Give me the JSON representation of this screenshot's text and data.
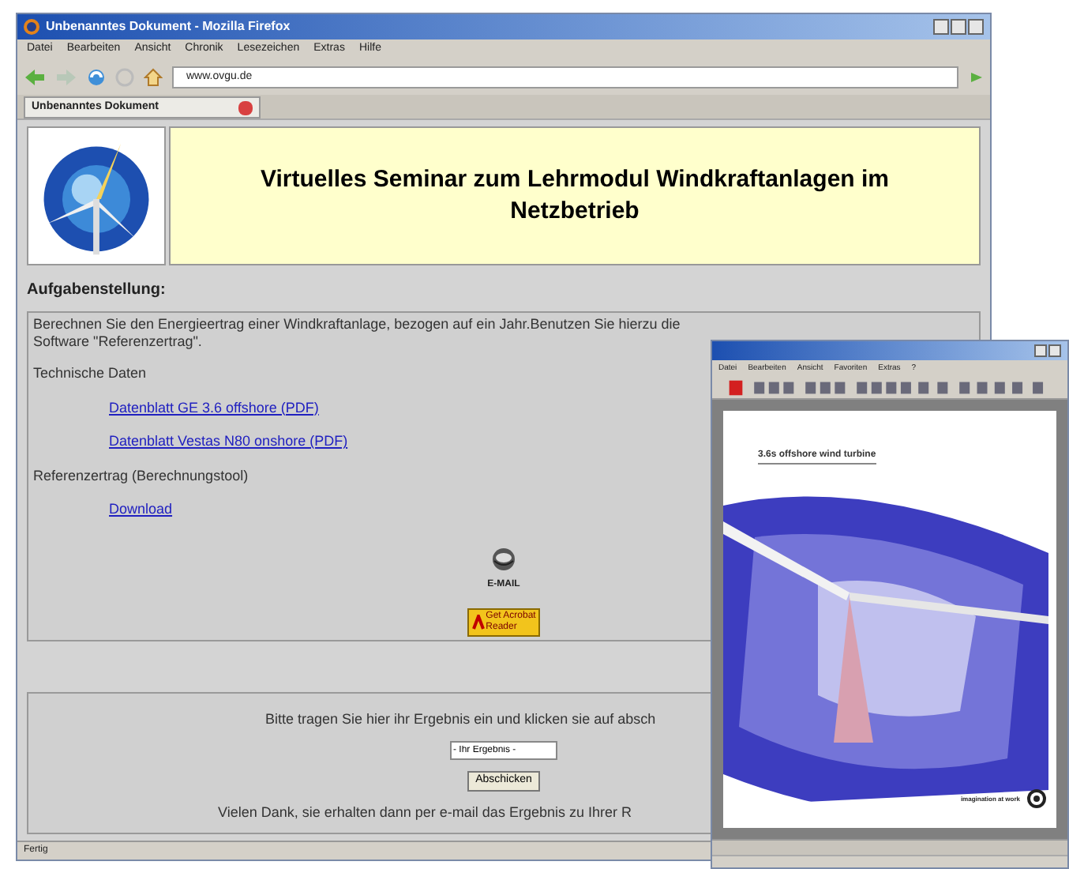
{
  "browser": {
    "title": "Unbenanntes Dokument - Mozilla Firefox",
    "menu": [
      "Datei",
      "Bearbeiten",
      "Ansicht",
      "Chronik",
      "Lesezeichen",
      "Extras",
      "Hilfe"
    ],
    "url": "www.ovgu.de",
    "tabs": [
      {
        "label": "Unbenanntes Dokument",
        "selected": true
      }
    ],
    "status": "Fertig"
  },
  "page": {
    "heading": "Virtuelles Seminar zum Lehrmodul Windkraftanlagen im Netzbetrieb",
    "task_title": "Aufgabenstellung:",
    "task_text": "Berechnen Sie den Energieertrag einer Windkraftanlage, bezogen auf ein Jahr.Benutzen Sie hierzu die Software \"Referenzertrag\".",
    "sections": [
      {
        "kind": "label",
        "text": "Technische Daten"
      },
      {
        "kind": "link",
        "text": "Datenblatt GE 3.6 offshore (PDF)"
      },
      {
        "kind": "link",
        "text": "Datenblatt Vestas N80 onshore (PDF)"
      },
      {
        "kind": "label",
        "text": "Referenzertrag (Berechnungstool)"
      },
      {
        "kind": "link",
        "text": "Download"
      }
    ],
    "email_label": "E-MAIL",
    "acrobat_badge": [
      "Get Acrobat",
      "Reader"
    ],
    "form_prompt": "Bitte tragen Sie hier ihr Ergebnis ein und klicken sie auf absch",
    "result_value": "- Ihr Ergebnis -",
    "submit": "Abschicken",
    "thanks": "Vielen Dank, sie erhalten dann per e-mail das Ergebnis zu Ihrer R"
  },
  "pdf_viewer": {
    "menu": [
      "Datei",
      "Bearbeiten",
      "Ansicht",
      "Favoriten",
      "Extras",
      "?"
    ],
    "doc_title": "3.6s offshore wind turbine",
    "tagline": "imagination at work"
  }
}
